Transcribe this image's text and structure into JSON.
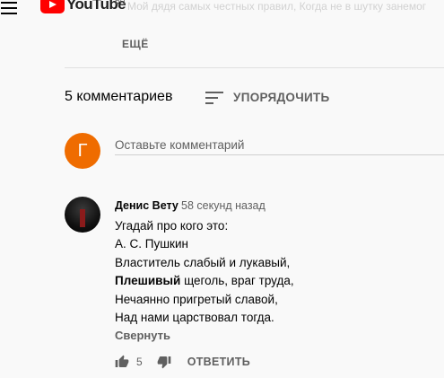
{
  "masthead": {
    "logo_text": "YouTube",
    "region": "RU",
    "faded_text": "Мой дядя самых честных правил, Когда не в шутку занемог"
  },
  "description": {
    "more_label": "ЕЩЁ"
  },
  "comments_header": {
    "count_label": "5 комментариев",
    "sort_label": "УПОРЯДОЧИТЬ"
  },
  "new_comment": {
    "avatar_letter": "Г",
    "placeholder": "Оставьте комментарий"
  },
  "comment": {
    "author": "Денис Вету",
    "time": "58 секунд назад",
    "lines": [
      "Угадай про кого это:",
      "А. С. Пушкин",
      "Властитель слабый и лукавый,",
      "щеголь, враг труда,",
      "Нечаянно пригретый славой,",
      "Над нами царствовал тогда."
    ],
    "bold_word": "Плешивый",
    "collapse_label": "Свернуть",
    "like_count": "5",
    "reply_label": "ОТВЕТИТЬ"
  },
  "colors": {
    "background": "#f9f9f9",
    "logo_red": "#ff0000",
    "avatar_orange": "#ef6c00",
    "secondary_text": "#606060"
  },
  "icons": [
    "hamburger-menu-icon",
    "youtube-play-icon",
    "sort-icon",
    "thumbs-up-icon",
    "thumbs-down-icon"
  ]
}
